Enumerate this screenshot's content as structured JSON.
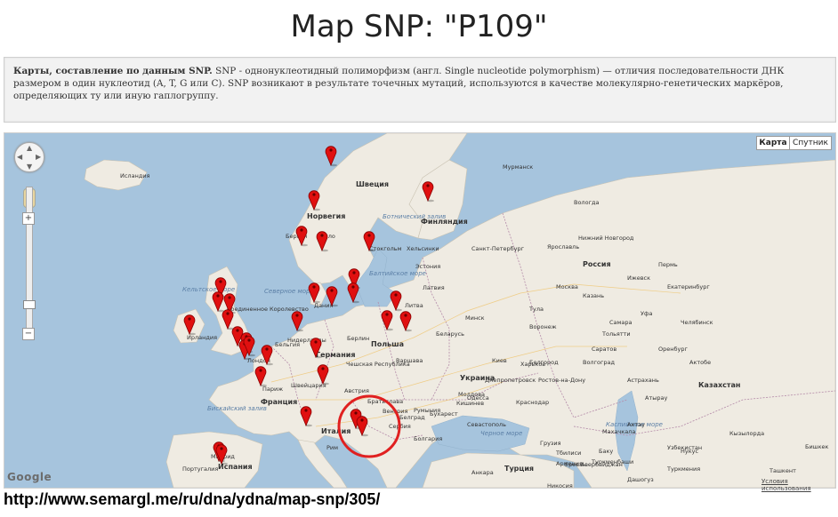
{
  "page": {
    "title": "Map SNP: \"P109\"",
    "source_url": "http://www.semargl.me/ru/dna/ydna/map-snp/305/"
  },
  "description": {
    "bold": "Карты, составление по данным SNP.",
    "text": " SNP - однонуклеотидный полиморфизм (англ. Single nucleotide polymorphism) — отличия последовательности ДНК размером в один нуклеотид (A, T, G или C). SNP возникают в результате точечных мутаций, используются в качестве молекулярно-генетических маркёров, определяющих ту или иную гаплогруппу."
  },
  "map": {
    "type_buttons": [
      "Карта",
      "Спутник"
    ],
    "selected_type": "Карта",
    "zoom_plus": "+",
    "zoom_minus": "−",
    "attribution": "Google",
    "terms_link": "Условия использования",
    "colors": {
      "water": "#a6c4dd",
      "land": "#efebe2",
      "border": "#b48aa8",
      "marker": "#e01010",
      "highlight": "#e02020"
    },
    "labels": [
      "Исландия",
      "Швеция",
      "Финляндия",
      "Норвегия",
      "Осло",
      "Берген",
      "Стокгольм",
      "Хельсинки",
      "Санкт-Петербург",
      "Эстония",
      "Латвия",
      "Литва",
      "Дания",
      "Северное море",
      "Соединенное Королевство",
      "Ирландия",
      "Нидерланды",
      "Германия",
      "Польша",
      "Беларусь",
      "Минск",
      "Россия",
      "Москва",
      "Украина",
      "Киев",
      "Франция",
      "Париж",
      "Бискайский залив",
      "Испания",
      "Мадрид",
      "Италия",
      "Рим",
      "Австрия",
      "Чешская Республика",
      "Венгрия",
      "Сербия",
      "Румыния",
      "Болгария",
      "Молдова",
      "Черное море",
      "Турция",
      "Грузия",
      "Казахстан",
      "Узбекистан",
      "Туркмения",
      "Каспийское море",
      "Екатеринбург",
      "Челябинск",
      "Уфа",
      "Казань",
      "Самара",
      "Волгоград",
      "Ростов-на-Дону",
      "Балтийское море",
      "Ботнический залив",
      "Азербайджан",
      "Армения",
      "Швейцария",
      "Бельгия",
      "Лондон",
      "Берлин",
      "Варшава",
      "Братислава",
      "Белград",
      "Бухарест",
      "Кельтское море",
      "Португалия",
      "Ижевск",
      "Пермь",
      "Оренбург",
      "Тольятти",
      "Саратов",
      "Воронеж",
      "Тула",
      "Ярославль",
      "Нижний Новгород",
      "Вологда",
      "Белгород",
      "Харьков",
      "Днепропетровск",
      "Одесса",
      "Кишинев",
      "Анкара",
      "Тбилиси",
      "Ереван",
      "Баку",
      "Астрахань",
      "Атырау",
      "Актобе",
      "Ташкент",
      "Бишкек",
      "Туркменбаши",
      "Дашогуз",
      "Нукус",
      "Кызылорда",
      "Актау",
      "Махачкала",
      "Краснодар",
      "Севастополь",
      "Никосия",
      "Мурманск"
    ]
  }
}
